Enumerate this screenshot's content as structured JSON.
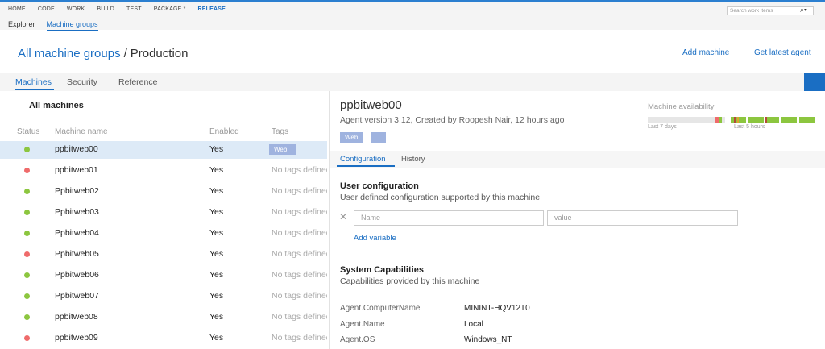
{
  "topnav": {
    "items": [
      "HOME",
      "CODE",
      "WORK",
      "BUILD",
      "TEST",
      "PACKAGE *",
      "RELEASE"
    ],
    "active_index": 6,
    "search_placeholder": "Search work items"
  },
  "subnav": {
    "items": [
      "Explorer",
      "Machine groups"
    ],
    "active_index": 1
  },
  "header": {
    "breadcrumb_root": "All machine groups",
    "separator": "/",
    "current": "Production",
    "add_machine": "Add machine",
    "get_latest_agent": "Get latest agent"
  },
  "tabs": {
    "items": [
      "Machines",
      "Security",
      "Reference"
    ],
    "active_index": 0
  },
  "machine_list": {
    "title": "All machines",
    "columns": [
      "Status",
      "Machine name",
      "Enabled",
      "Tags"
    ],
    "rows": [
      {
        "status": "online",
        "name": "ppbitweb00",
        "enabled": "Yes",
        "tags": "Web",
        "selected": true
      },
      {
        "status": "offline",
        "name": "ppbitweb01",
        "enabled": "Yes",
        "tags": "No tags defined"
      },
      {
        "status": "online",
        "name": "Ppbitweb02",
        "enabled": "Yes",
        "tags": "No tags defined"
      },
      {
        "status": "online",
        "name": "Ppbitweb03",
        "enabled": "Yes",
        "tags": "No tags defined"
      },
      {
        "status": "online",
        "name": "Ppbitweb04",
        "enabled": "Yes",
        "tags": "No tags defined"
      },
      {
        "status": "offline",
        "name": "Ppbitweb05",
        "enabled": "Yes",
        "tags": "No tags defined"
      },
      {
        "status": "online",
        "name": "Ppbitweb06",
        "enabled": "Yes",
        "tags": "No tags defined"
      },
      {
        "status": "online",
        "name": "Ppbitweb07",
        "enabled": "Yes",
        "tags": "No tags defined"
      },
      {
        "status": "online",
        "name": "ppbitweb08",
        "enabled": "Yes",
        "tags": "No tags defined"
      },
      {
        "status": "offline",
        "name": "ppbitweb09",
        "enabled": "Yes",
        "tags": "No tags defined"
      }
    ]
  },
  "detail": {
    "machine_name": "ppbitweb00",
    "subtitle": "Agent version 3.12, Created by Roopesh Nair, 12 hours ago",
    "tag": "Web",
    "availability": {
      "label": "Machine availability",
      "last7_caption": "Last 7 days",
      "last5h_caption": "Last 5 hours"
    },
    "tabs": [
      "Configuration",
      "History"
    ],
    "active_tab": 0,
    "user_config": {
      "title": "User configuration",
      "subtitle": "User defined configuration supported by this machine",
      "name_placeholder": "Name",
      "value_placeholder": "value",
      "add_variable": "Add variable"
    },
    "system_caps": {
      "title": "System Capabilities",
      "subtitle": "Capabilities provided by this machine",
      "items": [
        {
          "key": "Agent.ComputerName",
          "value": "MININT-HQV12T0"
        },
        {
          "key": "Agent.Name",
          "value": "Local"
        },
        {
          "key": "Agent.OS",
          "value": "Windows_NT"
        }
      ]
    }
  },
  "colors": {
    "accent": "#1a6ec3",
    "online": "#8cc63f",
    "offline": "#ef6b6b",
    "tag": "#9fb3df",
    "selected_row": "#ddeaf7"
  }
}
